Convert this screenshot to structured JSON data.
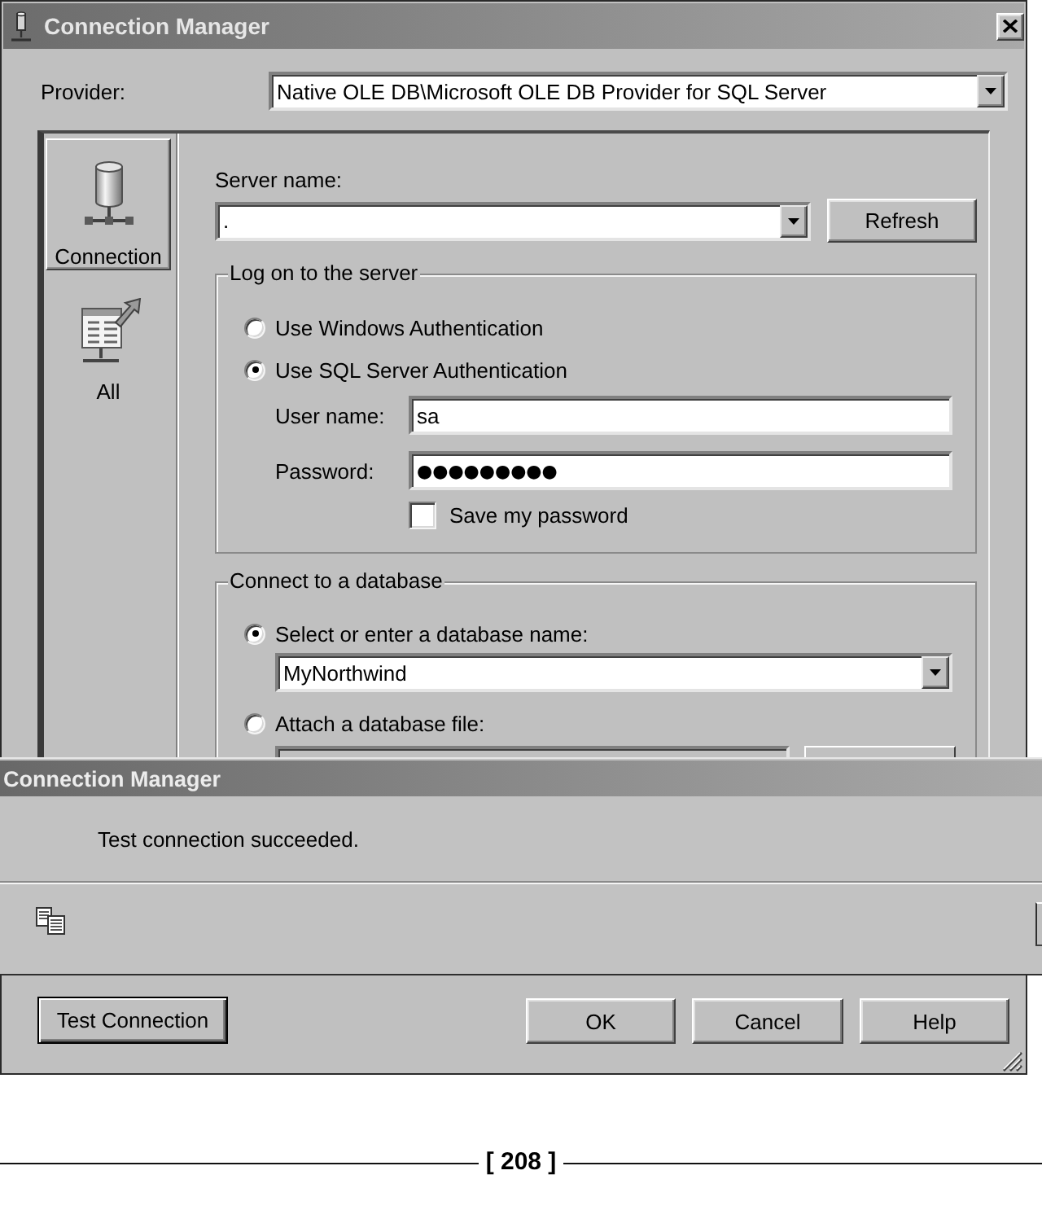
{
  "window": {
    "title": "Connection Manager"
  },
  "provider": {
    "label": "Provider:",
    "value": "Native OLE DB\\Microsoft OLE DB Provider for SQL Server"
  },
  "sidebar": {
    "items": [
      {
        "kind": "connection",
        "label": "Connection",
        "selected": true
      },
      {
        "kind": "all",
        "label": "All",
        "selected": false
      }
    ]
  },
  "server": {
    "label": "Server name:",
    "value": ".",
    "button": "Refresh"
  },
  "logon": {
    "title": "Log on to the server",
    "options": [
      {
        "label": "Use Windows Authentication",
        "selected": false
      },
      {
        "label": "Use SQL Server Authentication",
        "selected": true
      }
    ],
    "fields": [
      {
        "kind": "text",
        "label": "User name:",
        "value": "sa"
      },
      {
        "kind": "password",
        "label": "Password:",
        "value": "●●●●●●●●●"
      }
    ],
    "save_password": {
      "label": "Save my password",
      "checked": false
    }
  },
  "database": {
    "title": "Connect to a database",
    "options": [
      {
        "label": "Select or enter a database name:",
        "selected": true
      },
      {
        "label": "Attach a database file:",
        "selected": false
      }
    ],
    "database_name": "MyNorthwind"
  },
  "message_box": {
    "title": "Connection Manager",
    "message": "Test connection succeeded."
  },
  "left_buttons": [
    {
      "label": "Test Connection",
      "default": true
    }
  ],
  "right_buttons": [
    {
      "label": "OK",
      "default": false
    },
    {
      "label": "Cancel",
      "default": false
    },
    {
      "label": "Help",
      "default": false
    }
  ],
  "page_footer": {
    "page_number": "[ 208 ]"
  }
}
